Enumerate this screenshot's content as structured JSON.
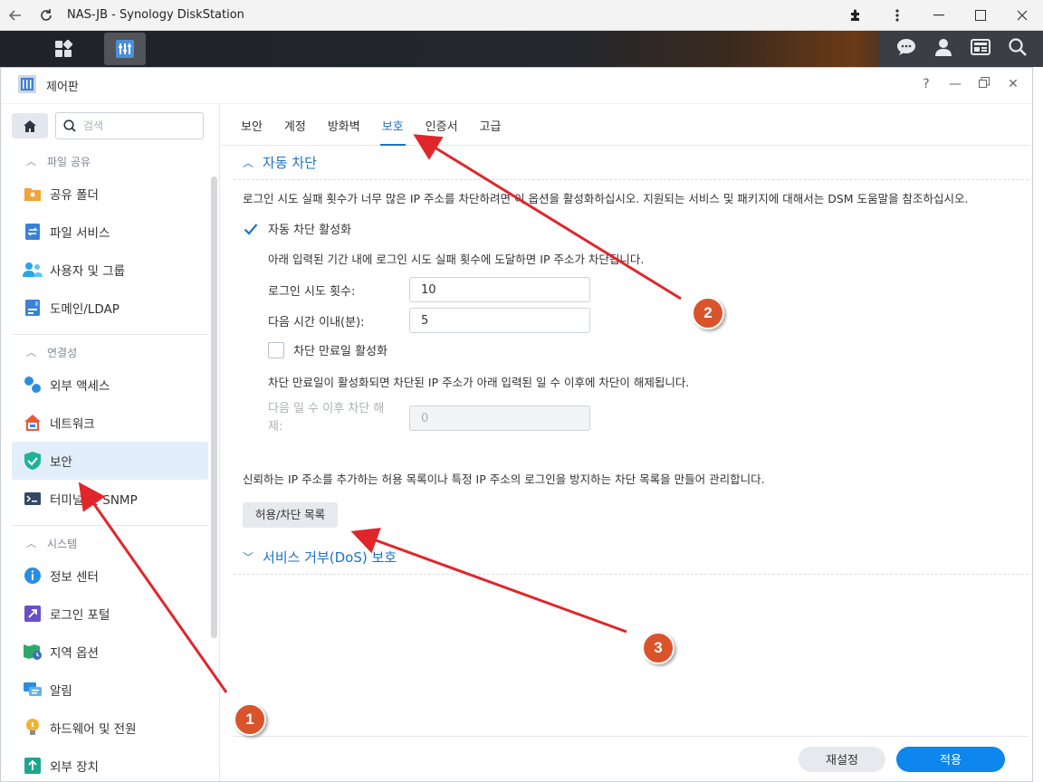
{
  "browser": {
    "title": "NAS-JB - Synology DiskStation"
  },
  "window": {
    "title": "제어판"
  },
  "sidebar": {
    "search_placeholder": "검색",
    "sections": [
      {
        "label": "파일 공유",
        "items": [
          {
            "label": "공유 폴더",
            "icon": "shared-folder-icon"
          },
          {
            "label": "파일 서비스",
            "icon": "file-services-icon"
          },
          {
            "label": "사용자 및 그룹",
            "icon": "user-group-icon"
          },
          {
            "label": "도메인/LDAP",
            "icon": "domain-ldap-icon"
          }
        ]
      },
      {
        "label": "연결성",
        "items": [
          {
            "label": "외부 액세스",
            "icon": "external-access-icon"
          },
          {
            "label": "네트워크",
            "icon": "network-icon"
          },
          {
            "label": "보안",
            "icon": "security-shield-icon"
          },
          {
            "label": "터미널 및 SNMP",
            "icon": "terminal-icon"
          }
        ]
      },
      {
        "label": "시스템",
        "items": [
          {
            "label": "정보 센터",
            "icon": "info-center-icon"
          },
          {
            "label": "로그인 포털",
            "icon": "login-portal-icon"
          },
          {
            "label": "지역 옵션",
            "icon": "regional-options-icon"
          },
          {
            "label": "알림",
            "icon": "notification-icon"
          },
          {
            "label": "하드웨어 및 전원",
            "icon": "hardware-power-icon"
          },
          {
            "label": "외부 장치",
            "icon": "external-devices-icon"
          }
        ]
      }
    ]
  },
  "tabs": [
    "보안",
    "계정",
    "방화벽",
    "보호",
    "인증서",
    "고급"
  ],
  "active_tab": "보호",
  "auto_block": {
    "heading": "자동 차단",
    "description": "로그인 시도 실패 횟수가 너무 많은 IP 주소를 차단하려면 이 옵션을 활성화하십시오. 지원되는 서비스 및 패키지에 대해서는 DSM 도움말을 참조하십시오.",
    "enable_label": "자동 차단 활성화",
    "enable_checked": true,
    "sub_description": "아래 입력된 기간 내에 로그인 시도 실패 횟수에 도달하면 IP 주소가 차단됩니다.",
    "attempts_label": "로그인 시도 횟수:",
    "attempts_value": "10",
    "within_label": "다음 시간 이내(분):",
    "within_value": "5",
    "expire_label": "차단 만료일 활성화",
    "expire_checked": false,
    "expire_description": "차단 만료일이 활성화되면 차단된 IP 주소가 아래 입력된 일 수 이후에 차단이 해제됩니다.",
    "unblock_label": "다음 일 수 이후 차단 해제:",
    "unblock_value": "0"
  },
  "allow_block": {
    "description": "신뢰하는 IP 주소를 추가하는 허용 목록이나 특정 IP 주소의 로그인을 방지하는 차단 목록을 만들어 관리합니다.",
    "button_label": "허용/차단 목록"
  },
  "dos": {
    "heading": "서비스 거부(DoS) 보호"
  },
  "footer": {
    "reset_label": "재설정",
    "apply_label": "적용"
  },
  "annotations": {
    "badge_1": "1",
    "badge_2": "2",
    "badge_3": "3",
    "arrow_color": "#e0262a",
    "badge_color": "#d9532b"
  },
  "colors": {
    "accent": "#1a73c8",
    "apply_button": "#0d86ee",
    "active_item_bg": "#e3eefb"
  }
}
